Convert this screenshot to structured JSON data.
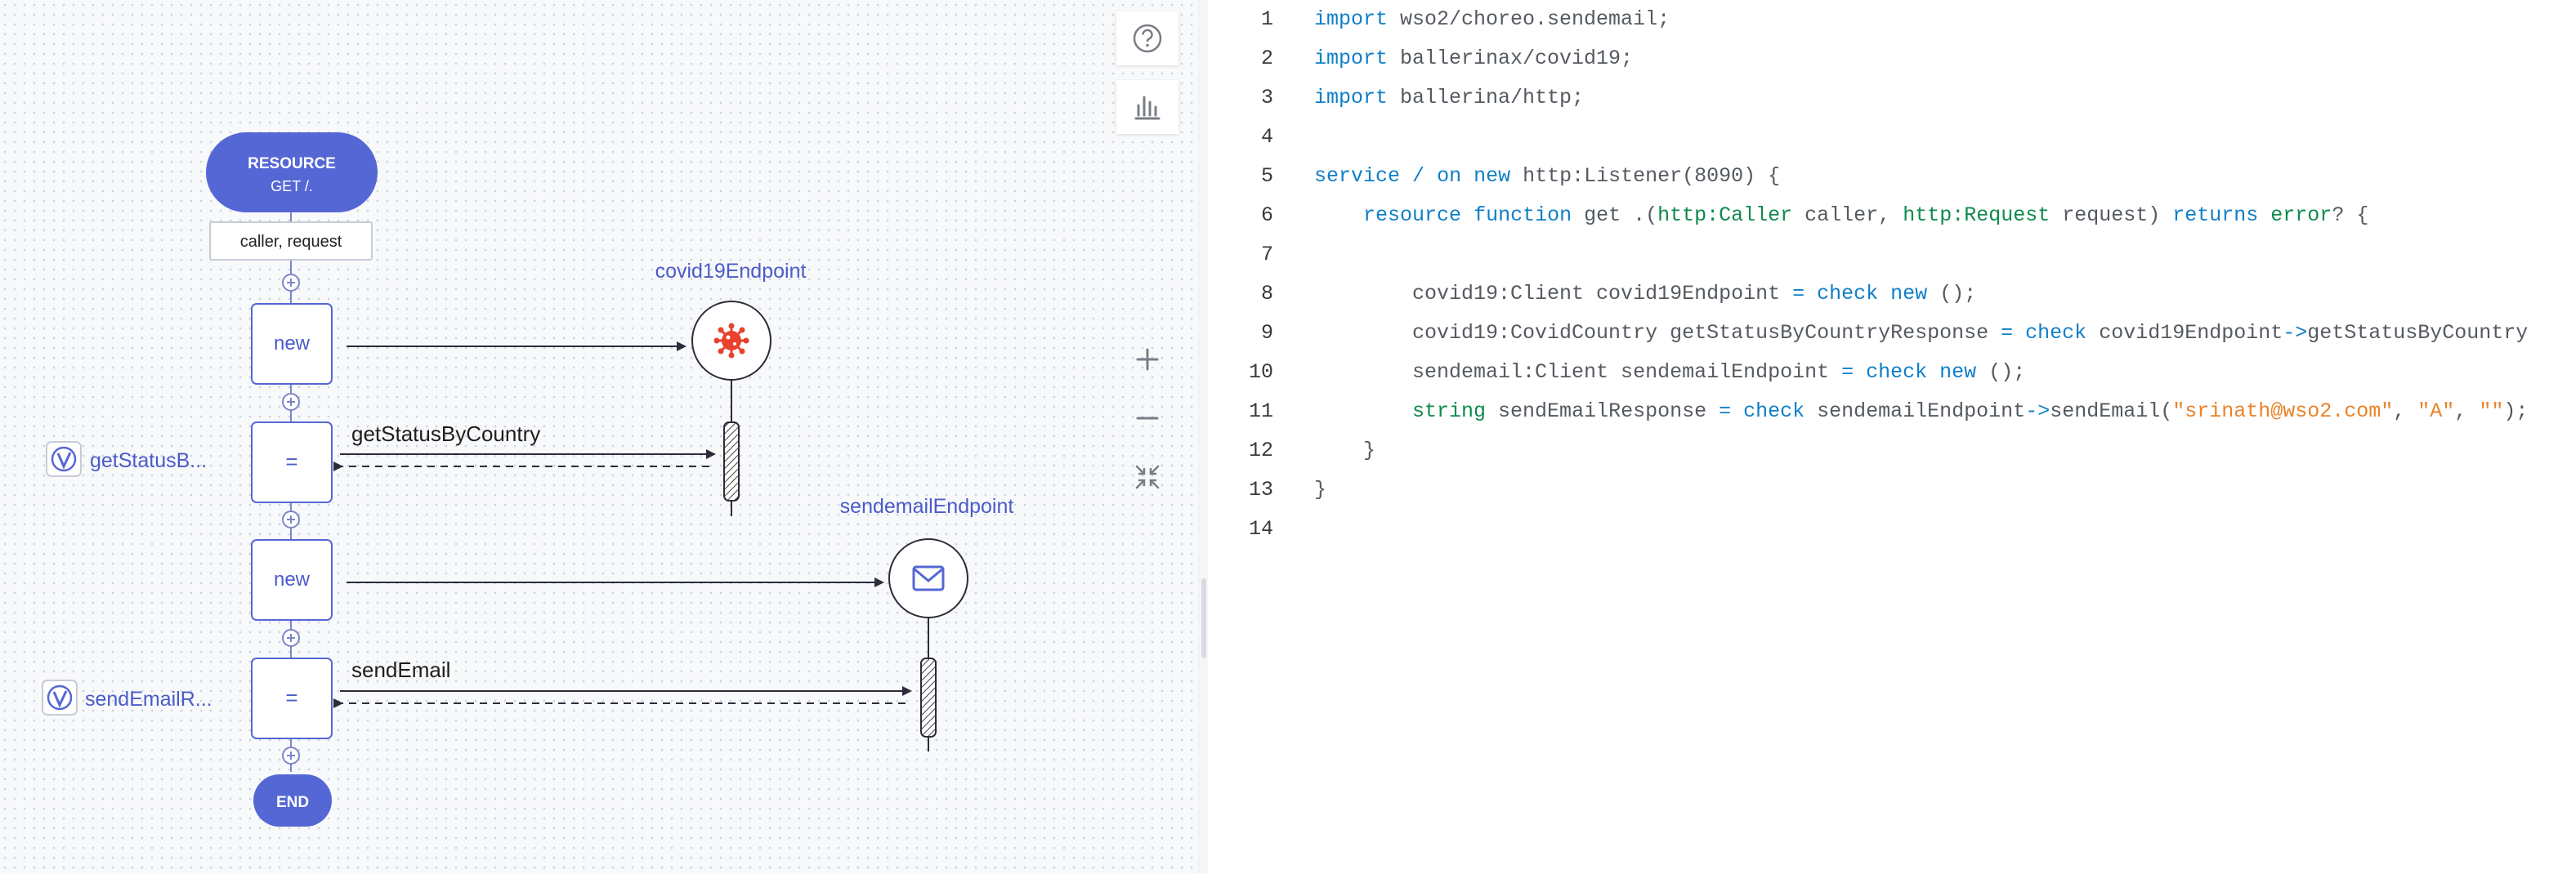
{
  "diagram": {
    "start_node": {
      "title": "RESOURCE",
      "subtitle": "GET /."
    },
    "params_label": "caller, request",
    "end_node": {
      "label": "END"
    },
    "statements": [
      {
        "label": "new"
      },
      {
        "label": "="
      },
      {
        "label": "new"
      },
      {
        "label": "="
      }
    ],
    "endpoints": [
      {
        "name": "covid19Endpoint",
        "icon": "virus-icon"
      },
      {
        "name": "sendemailEndpoint",
        "icon": "mail-icon"
      }
    ],
    "actions": [
      {
        "label": "getStatusByCountry"
      },
      {
        "label": "sendEmail"
      }
    ],
    "variables": [
      {
        "name": "getStatusB..."
      },
      {
        "name": "sendEmailR..."
      }
    ],
    "colors": {
      "primary": "#5567d5",
      "virus": "#e8412c"
    }
  },
  "toolbar": {
    "help_icon": "help-icon",
    "chart_icon": "chart-icon"
  },
  "zoom": {
    "in_icon": "plus-icon",
    "out_icon": "minus-icon",
    "fit_icon": "fit-to-screen-icon"
  },
  "code": {
    "lines": [
      {
        "n": "1",
        "tokens": [
          {
            "t": "import",
            "c": "kw"
          },
          {
            "t": " wso2/choreo.sendemail;"
          }
        ]
      },
      {
        "n": "2",
        "tokens": [
          {
            "t": "import",
            "c": "kw"
          },
          {
            "t": " ballerinax/covid19;"
          }
        ]
      },
      {
        "n": "3",
        "tokens": [
          {
            "t": "import",
            "c": "kw"
          },
          {
            "t": " ballerina/http;"
          }
        ]
      },
      {
        "n": "4",
        "tokens": []
      },
      {
        "n": "5",
        "tokens": [
          {
            "t": "service",
            "c": "kw"
          },
          {
            "t": " "
          },
          {
            "t": "/",
            "c": "op"
          },
          {
            "t": " "
          },
          {
            "t": "on",
            "c": "kw"
          },
          {
            "t": " "
          },
          {
            "t": "new",
            "c": "kw"
          },
          {
            "t": " http:Listener(8090) {"
          }
        ]
      },
      {
        "n": "6",
        "tokens": [
          {
            "t": "    "
          },
          {
            "t": "resource",
            "c": "kw"
          },
          {
            "t": " "
          },
          {
            "t": "function",
            "c": "kw"
          },
          {
            "t": " get .("
          },
          {
            "t": "http:Caller",
            "c": "ty"
          },
          {
            "t": " caller, "
          },
          {
            "t": "http:Request",
            "c": "ty"
          },
          {
            "t": " request) "
          },
          {
            "t": "returns",
            "c": "kw"
          },
          {
            "t": " "
          },
          {
            "t": "error",
            "c": "ty"
          },
          {
            "t": "? {"
          }
        ]
      },
      {
        "n": "7",
        "tokens": []
      },
      {
        "n": "8",
        "tokens": [
          {
            "t": "        covid19:Client covid19Endpoint "
          },
          {
            "t": "=",
            "c": "op"
          },
          {
            "t": " "
          },
          {
            "t": "check",
            "c": "kw"
          },
          {
            "t": " "
          },
          {
            "t": "new",
            "c": "kw"
          },
          {
            "t": " ();"
          }
        ]
      },
      {
        "n": "9",
        "tokens": [
          {
            "t": "        covid19:CovidCountry getStatusByCountryResponse "
          },
          {
            "t": "=",
            "c": "op"
          },
          {
            "t": " "
          },
          {
            "t": "check",
            "c": "kw"
          },
          {
            "t": " covid19Endpoint"
          },
          {
            "t": "->",
            "c": "op"
          },
          {
            "t": "getStatusByCountry"
          }
        ]
      },
      {
        "n": "10",
        "tokens": [
          {
            "t": "        sendemail:Client sendemailEndpoint "
          },
          {
            "t": "=",
            "c": "op"
          },
          {
            "t": " "
          },
          {
            "t": "check",
            "c": "kw"
          },
          {
            "t": " "
          },
          {
            "t": "new",
            "c": "kw"
          },
          {
            "t": " ();"
          }
        ]
      },
      {
        "n": "11",
        "tokens": [
          {
            "t": "        "
          },
          {
            "t": "string",
            "c": "ty"
          },
          {
            "t": " sendEmailResponse "
          },
          {
            "t": "=",
            "c": "op"
          },
          {
            "t": " "
          },
          {
            "t": "check",
            "c": "kw"
          },
          {
            "t": " sendemailEndpoint"
          },
          {
            "t": "->",
            "c": "op"
          },
          {
            "t": "sendEmail("
          },
          {
            "t": "\"srinath@wso2.com\"",
            "c": "str"
          },
          {
            "t": ", "
          },
          {
            "t": "\"A\"",
            "c": "str"
          },
          {
            "t": ", "
          },
          {
            "t": "\"\"",
            "c": "str"
          },
          {
            "t": ");"
          }
        ]
      },
      {
        "n": "12",
        "tokens": [
          {
            "t": "    }"
          }
        ]
      },
      {
        "n": "13",
        "tokens": [
          {
            "t": "}"
          }
        ]
      },
      {
        "n": "14",
        "tokens": []
      }
    ]
  }
}
